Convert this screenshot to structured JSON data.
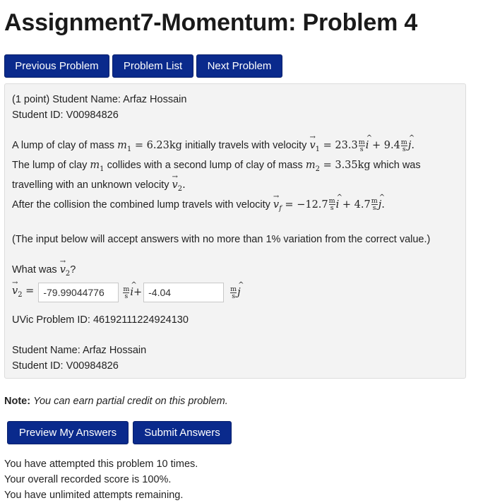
{
  "page_title": "Assignment7-Momentum: Problem 4",
  "nav": {
    "previous": "Previous Problem",
    "list": "Problem List",
    "next": "Next Problem"
  },
  "problem": {
    "points": "(1 point) Student Name: Arfaz Hossain",
    "student_id": "Student ID: V00984826",
    "line1_pre": "A lump of clay of mass ",
    "m1_value": "6.23kg",
    "line1_mid": " initially travels with velocity ",
    "v1_x": "23.3",
    "v1_y": "9.4",
    "line2_pre": "The lump of clay ",
    "line2_mid": " collides with a second lump of clay of mass ",
    "m2_value": "3.35kg",
    "line2_post": " which was",
    "line3": "travelling with an unknown velocity ",
    "line4_pre": "After the collision the combined lump travels with velocity ",
    "vf_x": "−12.7",
    "vf_y": "4.7",
    "tolerance": "(The input below will accept answers with no more than 1% variation from the correct value.)",
    "question_pre": "What was ",
    "question_post": "?",
    "answer_x": "-79.99044776",
    "answer_y": "-4.04",
    "uvic_id": "UVic Problem ID: 46192111224924130",
    "student_name_repeat": "Student Name: Arfaz Hossain",
    "student_id_repeat": "Student ID: V00984826",
    "unit_num": "m",
    "unit_den": "s"
  },
  "note": {
    "label": "Note:",
    "text": "You can earn partial credit on this problem."
  },
  "actions": {
    "preview": "Preview My Answers",
    "submit": "Submit Answers"
  },
  "status": {
    "attempts": "You have attempted this problem 10 times.",
    "score": "Your overall recorded score is 100%.",
    "remaining": "You have unlimited attempts remaining."
  }
}
